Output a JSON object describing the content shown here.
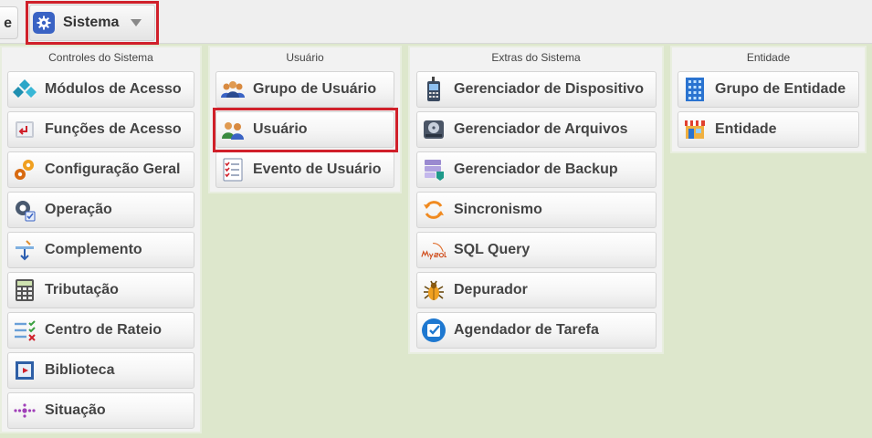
{
  "topbar": {
    "prev_tab_label": "e",
    "menu_button_label": "Sistema"
  },
  "panels": [
    {
      "title": "Controles do Sistema",
      "items": [
        {
          "label": "Módulos de Acesso",
          "icon": "modules-icon"
        },
        {
          "label": "Funções de Acesso",
          "icon": "functions-icon"
        },
        {
          "label": "Configuração Geral",
          "icon": "gears-icon"
        },
        {
          "label": "Operação",
          "icon": "operation-gear-icon"
        },
        {
          "label": "Complemento",
          "icon": "complement-icon"
        },
        {
          "label": "Tributação",
          "icon": "calculator-icon"
        },
        {
          "label": "Centro de Rateio",
          "icon": "checklist-icon"
        },
        {
          "label": "Biblioteca",
          "icon": "library-icon"
        },
        {
          "label": "Situação",
          "icon": "status-dots-icon"
        }
      ]
    },
    {
      "title": "Usuário",
      "items": [
        {
          "label": "Grupo de Usuário",
          "icon": "user-group-icon"
        },
        {
          "label": "Usuário",
          "icon": "users-icon"
        },
        {
          "label": "Evento de Usuário",
          "icon": "event-list-icon"
        }
      ]
    },
    {
      "title": "Extras do Sistema",
      "items": [
        {
          "label": "Gerenciador de Dispositivo",
          "icon": "device-icon"
        },
        {
          "label": "Gerenciador de Arquivos",
          "icon": "hard-drive-icon"
        },
        {
          "label": "Gerenciador de Backup",
          "icon": "backup-icon"
        },
        {
          "label": "Sincronismo",
          "icon": "sync-icon"
        },
        {
          "label": "SQL Query",
          "icon": "mysql-icon"
        },
        {
          "label": "Depurador",
          "icon": "bug-icon"
        },
        {
          "label": "Agendador de Tarefa",
          "icon": "scheduler-check-icon"
        }
      ]
    },
    {
      "title": "Entidade",
      "items": [
        {
          "label": "Grupo de Entidade",
          "icon": "building-icon"
        },
        {
          "label": "Entidade",
          "icon": "store-icon"
        }
      ]
    }
  ],
  "colors": {
    "highlight": "#d0202a",
    "background": "#dde7cc",
    "accent_blue": "#3a63c4"
  }
}
